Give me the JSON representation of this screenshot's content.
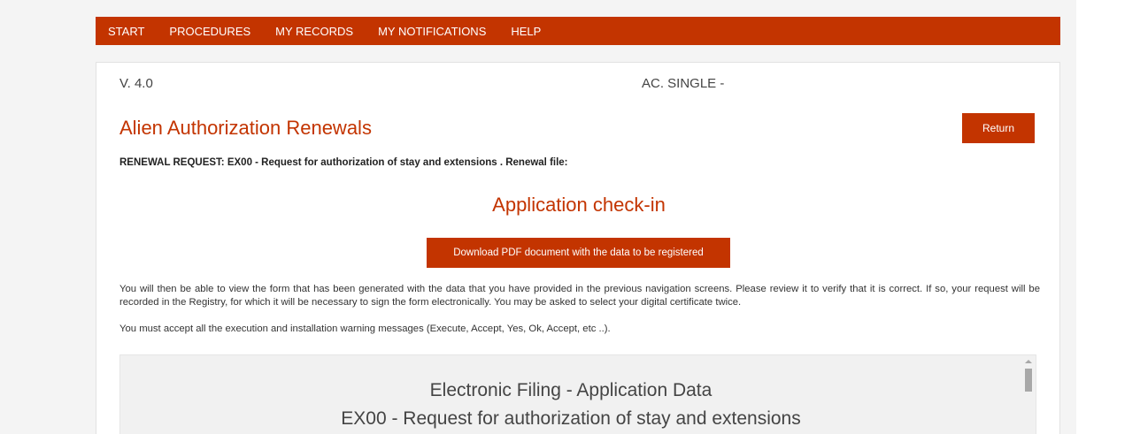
{
  "nav": {
    "items": [
      "START",
      "PROCEDURES",
      "MY RECORDS",
      "MY NOTIFICATIONS",
      "HELP"
    ]
  },
  "header": {
    "version": "V. 4.0",
    "ac_label": "AC. SINGLE -"
  },
  "page": {
    "title": "Alien Authorization Renewals",
    "return_label": "Return",
    "renewal_line": "RENEWAL REQUEST: EX00 - Request for authorization of stay and extensions . Renewal file:"
  },
  "checkin": {
    "heading": "Application check-in",
    "download_label": "Download PDF document with the data to be registered",
    "info_text": "You will then be able to view the form that has been generated with the data that you have provided in the previous navigation screens. Please review it to verify that it is correct. If so, your request will be recorded in the Registry, for which it will be necessary to sign the form electronically. You may be asked to select your digital certificate twice.",
    "warning_text": "You must accept all the execution and installation warning messages (Execute, Accept, Yes, Ok, Accept, etc ..)."
  },
  "document": {
    "title": "Electronic Filing - Application Data",
    "subtitle": "EX00 - Request for authorization of stay and extensions"
  },
  "colors": {
    "accent": "#c33400",
    "page_bg": "#f4f4f4",
    "frame_bg": "#f1f1f1"
  },
  "icons": {
    "scroll_up": "scroll-up-arrow-icon"
  }
}
